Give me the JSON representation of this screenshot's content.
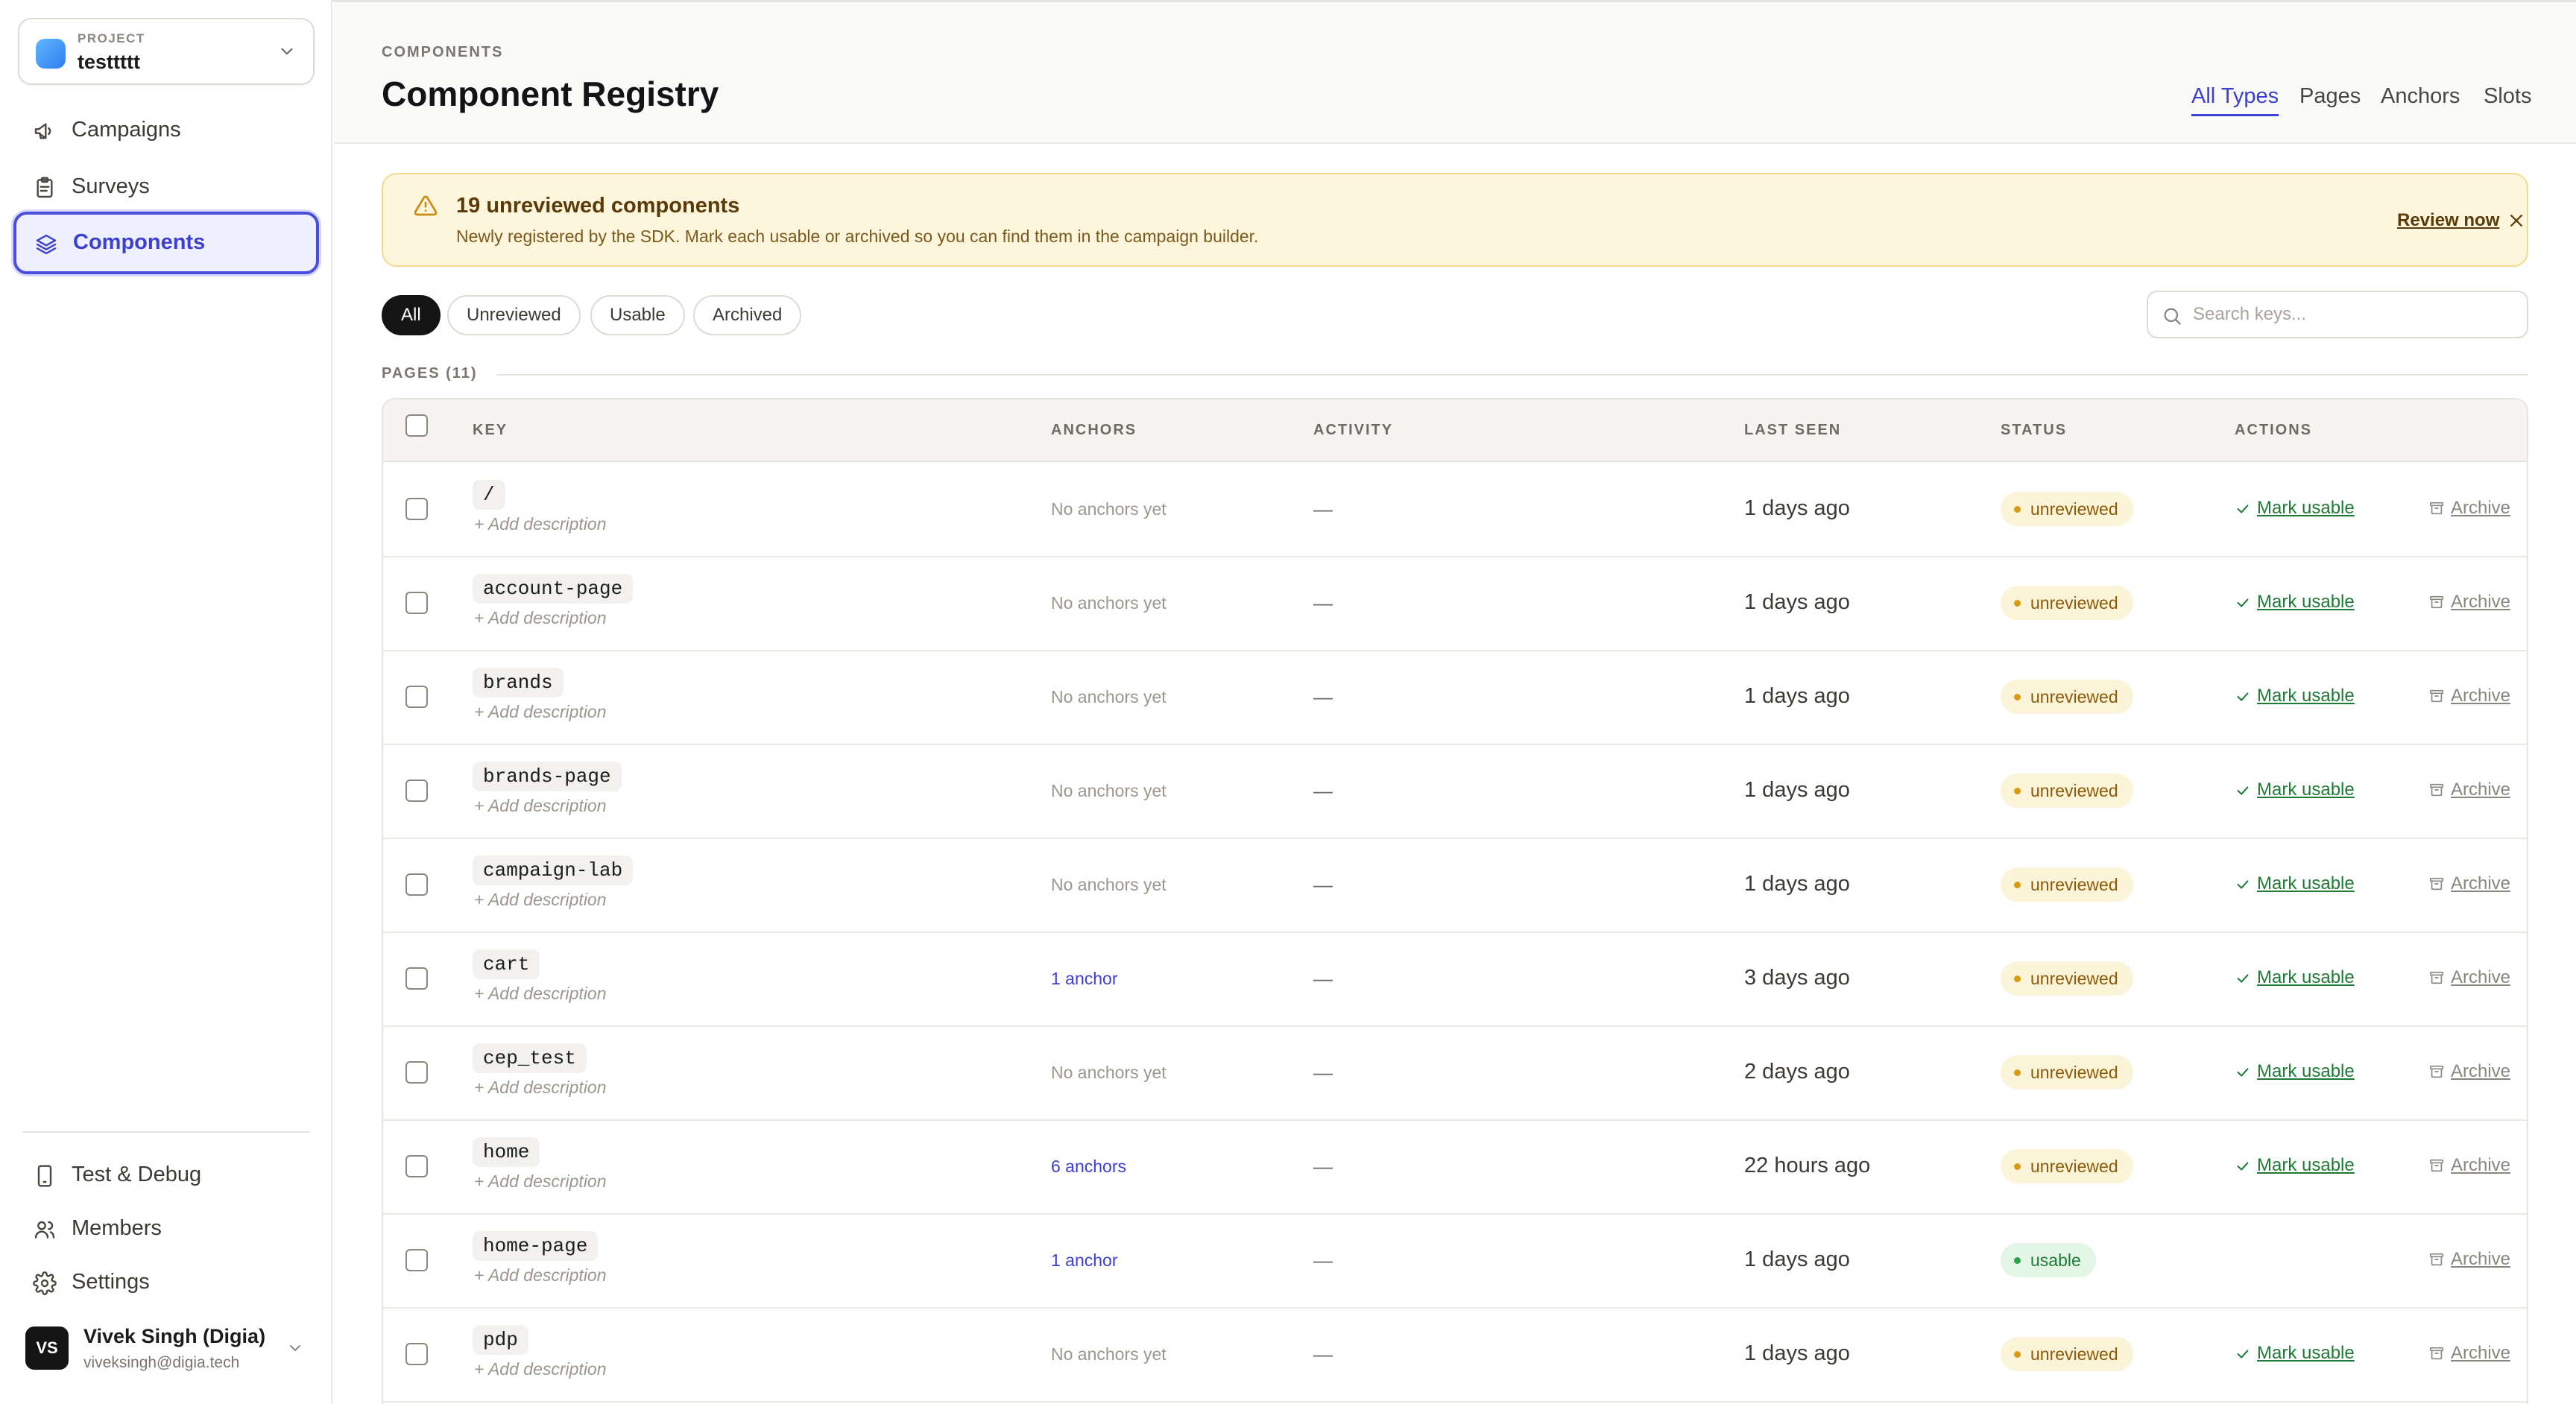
{
  "sidebar": {
    "project": {
      "eyebrow": "PROJECT",
      "name": "testtttt"
    },
    "nav": [
      {
        "label": "Campaigns",
        "icon": "megaphone-icon",
        "active": false
      },
      {
        "label": "Surveys",
        "icon": "clipboard-icon",
        "active": false
      },
      {
        "label": "Components",
        "icon": "layers-icon",
        "active": true
      }
    ],
    "bottom_nav": [
      {
        "label": "Test & Debug",
        "icon": "phone-icon"
      },
      {
        "label": "Members",
        "icon": "users-icon"
      },
      {
        "label": "Settings",
        "icon": "gear-icon"
      }
    ],
    "user": {
      "initials": "VS",
      "name": "Vivek Singh (Digia)",
      "email": "viveksingh@digia.tech"
    }
  },
  "header": {
    "eyebrow": "COMPONENTS",
    "title": "Component Registry",
    "tabs": [
      {
        "label": "All Types",
        "active": true
      },
      {
        "label": "Pages",
        "active": false
      },
      {
        "label": "Anchors",
        "active": false
      },
      {
        "label": "Slots",
        "active": false
      }
    ]
  },
  "banner": {
    "title": "19 unreviewed components",
    "text": "Newly registered by the SDK. Mark each usable or archived so you can find them in the campaign builder.",
    "link": "Review now"
  },
  "filters": [
    {
      "label": "All",
      "active": true
    },
    {
      "label": "Unreviewed",
      "active": false
    },
    {
      "label": "Usable",
      "active": false
    },
    {
      "label": "Archived",
      "active": false
    }
  ],
  "search": {
    "placeholder": "Search keys...",
    "value": ""
  },
  "section": {
    "label": "PAGES (11)"
  },
  "table": {
    "columns": {
      "key": "KEY",
      "anchors": "ANCHORS",
      "activity": "ACTIVITY",
      "last_seen": "LAST SEEN",
      "status": "STATUS",
      "actions": "ACTIONS"
    },
    "add_description": "+ Add description",
    "mark_usable": "Mark usable",
    "archive": "Archive",
    "rows": [
      {
        "key": "/",
        "anchors": "No anchors yet",
        "anchors_link": false,
        "activity": "—",
        "last_seen": "1 days ago",
        "status": "unreviewed"
      },
      {
        "key": "account-page",
        "anchors": "No anchors yet",
        "anchors_link": false,
        "activity": "—",
        "last_seen": "1 days ago",
        "status": "unreviewed"
      },
      {
        "key": "brands",
        "anchors": "No anchors yet",
        "anchors_link": false,
        "activity": "—",
        "last_seen": "1 days ago",
        "status": "unreviewed"
      },
      {
        "key": "brands-page",
        "anchors": "No anchors yet",
        "anchors_link": false,
        "activity": "—",
        "last_seen": "1 days ago",
        "status": "unreviewed"
      },
      {
        "key": "campaign-lab",
        "anchors": "No anchors yet",
        "anchors_link": false,
        "activity": "—",
        "last_seen": "1 days ago",
        "status": "unreviewed"
      },
      {
        "key": "cart",
        "anchors": "1 anchor",
        "anchors_link": true,
        "activity": "—",
        "last_seen": "3 days ago",
        "status": "unreviewed"
      },
      {
        "key": "cep_test",
        "anchors": "No anchors yet",
        "anchors_link": false,
        "activity": "—",
        "last_seen": "2 days ago",
        "status": "unreviewed"
      },
      {
        "key": "home",
        "anchors": "6 anchors",
        "anchors_link": true,
        "activity": "—",
        "last_seen": "22 hours ago",
        "status": "unreviewed"
      },
      {
        "key": "home-page",
        "anchors": "1 anchor",
        "anchors_link": true,
        "activity": "—",
        "last_seen": "1 days ago",
        "status": "usable"
      },
      {
        "key": "pdp",
        "anchors": "No anchors yet",
        "anchors_link": false,
        "activity": "—",
        "last_seen": "1 days ago",
        "status": "unreviewed"
      }
    ]
  }
}
